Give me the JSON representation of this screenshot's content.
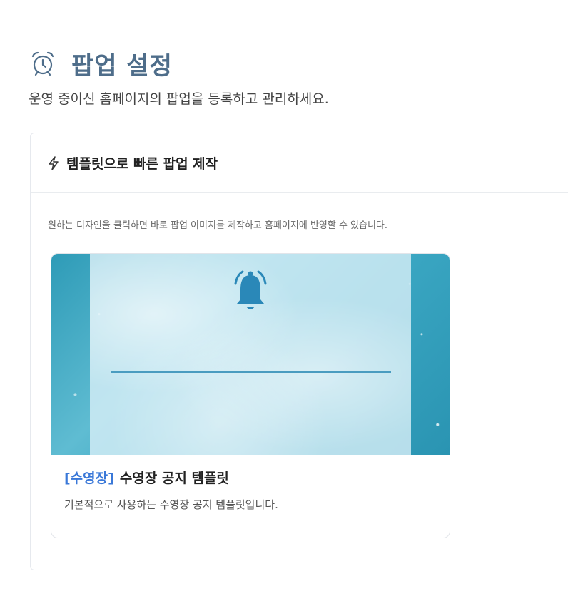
{
  "header": {
    "title": "팝업 설정",
    "subtitle": "운영 중이신 홈페이지의 팝업을 등록하고 관리하세요.",
    "icon": "alarm-clock-icon",
    "accent_color": "#4e6d8a"
  },
  "template_panel": {
    "icon": "lightning-bolt-icon",
    "title": "템플릿으로 빠른 팝업 제작",
    "description": "원하는 디자인을 클릭하면 바로 팝업 이미지를 제작하고 홈페이지에 반영할 수 있습니다.",
    "cards": [
      {
        "tag": "[수영장]",
        "title": "수영장 공지 템플릿",
        "description": "기본적으로 사용하는 수영장 공지 템플릿입니다.",
        "thumbnail_icon": "bell-icon",
        "tag_color": "#3a78d8"
      }
    ]
  }
}
